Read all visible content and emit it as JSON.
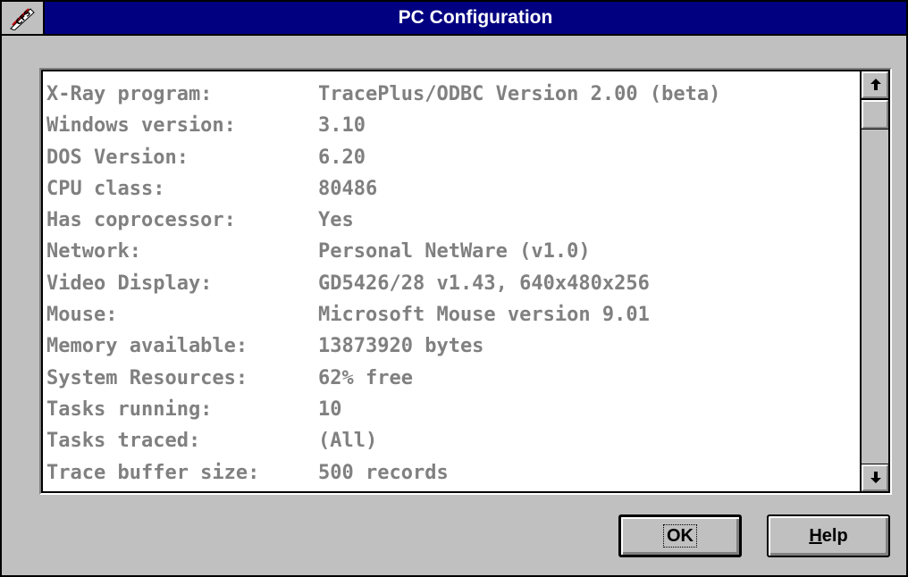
{
  "window": {
    "title": "PC Configuration"
  },
  "icons": {
    "system_menu": "cfs-app-icon",
    "scroll_up": "arrow-up-icon",
    "scroll_down": "arrow-down-icon"
  },
  "config": {
    "rows": [
      {
        "key": "X-Ray program:",
        "value": "TracePlus/ODBC Version 2.00 (beta)"
      },
      {
        "key": "Windows version:",
        "value": "3.10"
      },
      {
        "key": "DOS Version:",
        "value": "6.20"
      },
      {
        "key": "CPU class:",
        "value": "80486"
      },
      {
        "key": "Has coprocessor:",
        "value": "Yes"
      },
      {
        "key": "Network:",
        "value": "Personal NetWare (v1.0)"
      },
      {
        "key": "Video Display:",
        "value": "GD5426/28 v1.43, 640x480x256"
      },
      {
        "key": "Mouse:",
        "value": "Microsoft Mouse version 9.01"
      },
      {
        "key": "Memory available:",
        "value": "13873920 bytes"
      },
      {
        "key": "System Resources:",
        "value": "62% free"
      },
      {
        "key": "Tasks running:",
        "value": "10"
      },
      {
        "key": "Tasks traced:",
        "value": "(All)"
      },
      {
        "key": "Trace buffer size:",
        "value": "500 records"
      }
    ]
  },
  "buttons": {
    "ok": "OK",
    "help_mnemonic": "H",
    "help_rest": "elp"
  },
  "colors": {
    "titlebar": "#000080",
    "face": "#c0c0c0",
    "list_text": "#808080"
  }
}
